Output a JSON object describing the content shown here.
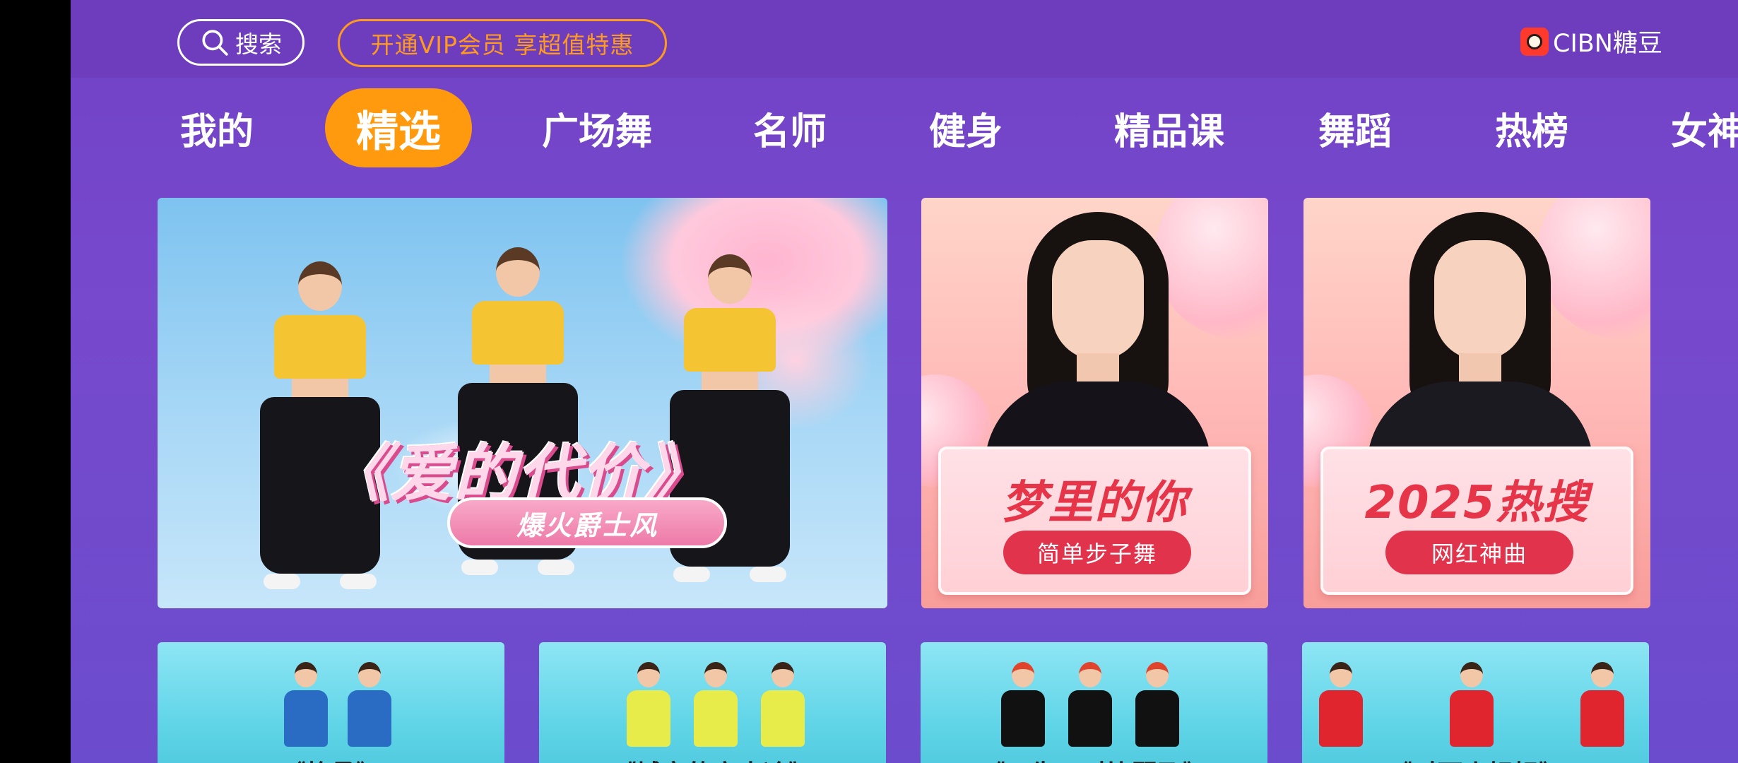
{
  "header": {
    "search_label": "搜索",
    "vip_label": "开通VIP会员 享超值特惠",
    "logo_text": "CIBN糖豆"
  },
  "nav": {
    "active_index": 1,
    "items": [
      {
        "label": "我的"
      },
      {
        "label": "精选"
      },
      {
        "label": "广场舞"
      },
      {
        "label": "名师"
      },
      {
        "label": "健身"
      },
      {
        "label": "精品课"
      },
      {
        "label": "舞蹈"
      },
      {
        "label": "热榜"
      },
      {
        "label": "女神"
      }
    ]
  },
  "hero": {
    "title": "《爱的代价》",
    "tag": "爆火爵士风"
  },
  "promos": [
    {
      "title": "梦里的你",
      "tag": "简单步子舞"
    },
    {
      "title": "2025热搜",
      "tag": "网红神曲"
    }
  ],
  "thumbnails": [
    {
      "title": "《格桑》"
    },
    {
      "title": "《城市的夜太冷》"
    },
    {
      "title": "《天生一对比翼飞》"
    },
    {
      "title": "《对面小姐姐》"
    }
  ],
  "colors": {
    "background": "#7142c6",
    "active_tab": "#ff9a0e",
    "vip_accent": "#ff9a1f",
    "promo_red": "#e2334c"
  }
}
